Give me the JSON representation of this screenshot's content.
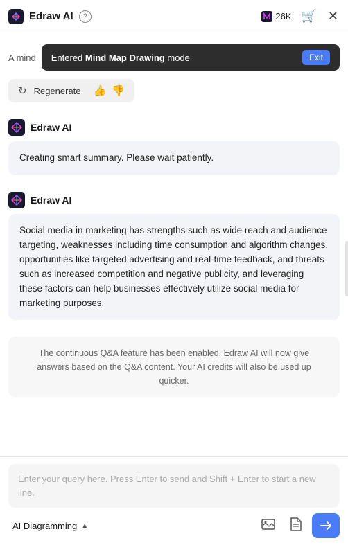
{
  "header": {
    "title": "Edraw AI",
    "help_label": "?",
    "credits": "26K",
    "close_label": "✕"
  },
  "toast": {
    "prefix": "A mind",
    "text_normal": "Entered ",
    "text_bold": "Mind Map Drawing",
    "text_suffix": " mode",
    "exit_label": "Exit"
  },
  "regenerate": {
    "label": "Regenerate",
    "icon": "↻"
  },
  "feedback": {
    "thumbs_up": "👍",
    "thumbs_down": "👎"
  },
  "messages": [
    {
      "sender": "Edraw AI",
      "content": "Creating smart summary. Please wait patiently."
    },
    {
      "sender": "Edraw AI",
      "content": "Social media in marketing has strengths such as wide reach and audience targeting, weaknesses including time consumption and algorithm changes, opportunities like targeted advertising and real-time feedback, and threats such as increased competition and negative publicity, and leveraging these factors can help businesses effectively utilize social media for marketing purposes."
    }
  ],
  "qa_notice": "The continuous Q&A feature has been enabled. Edraw AI will now give answers based on the Q&A content. Your AI credits will also be used up quicker.",
  "input": {
    "placeholder": "Enter your query here. Press Enter to send and Shift + Enter to start a new line."
  },
  "toolbar": {
    "ai_diagramming_label": "AI Diagramming",
    "icon1_label": "image-icon",
    "icon2_label": "file-icon",
    "send_label": "➤"
  }
}
